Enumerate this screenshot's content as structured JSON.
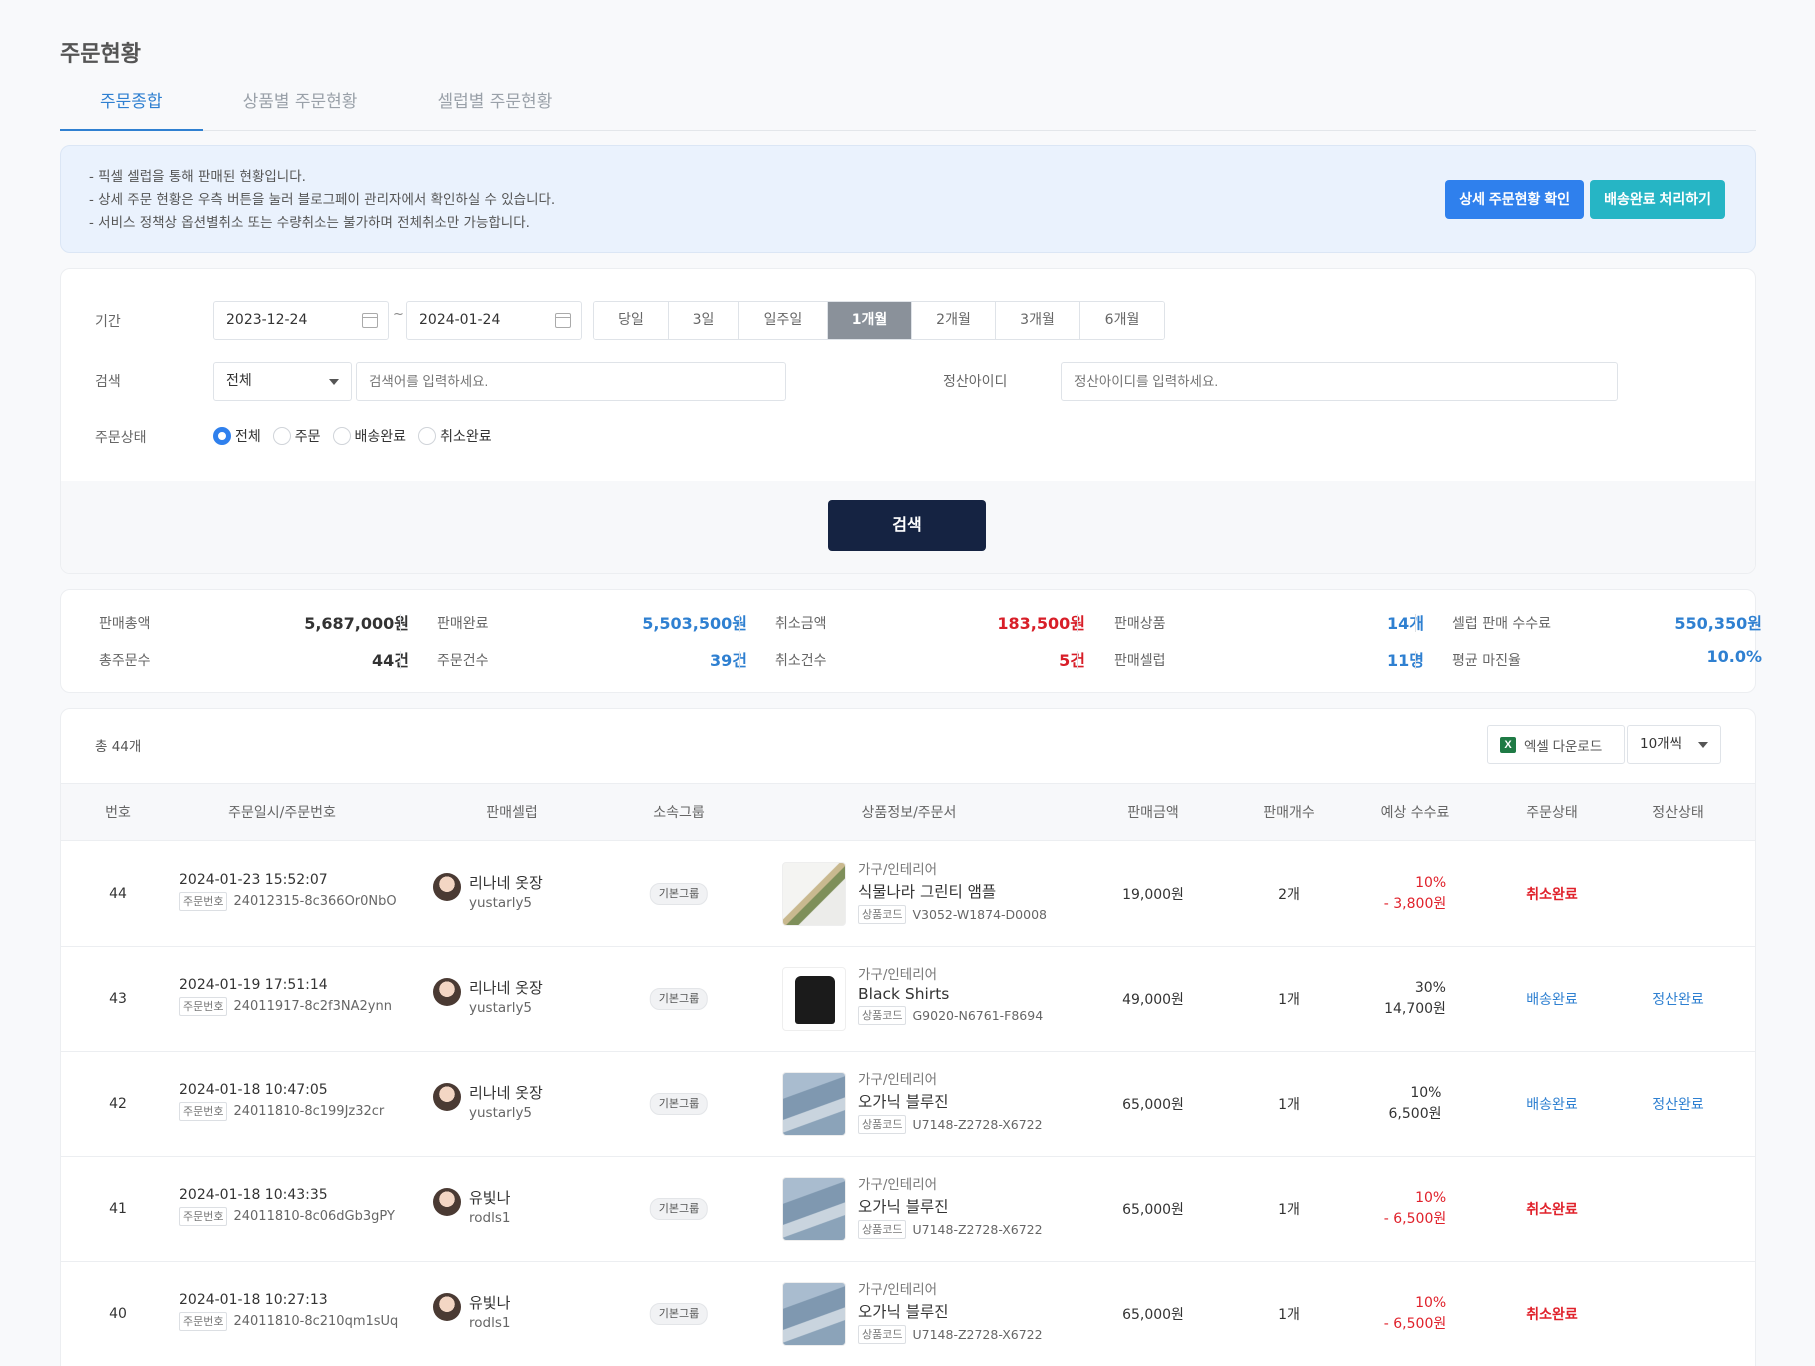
{
  "page_title": "주문현황",
  "tabs": [
    "주문종합",
    "상품별 주문현황",
    "셀럽별 주문현황"
  ],
  "notice": {
    "lines": [
      "- 픽셀 셀럽을 통해 판매된 현황입니다.",
      "- 상세 주문 현황은 우측 버튼을 눌러 블로그페이 관리자에서 확인하실 수 있습니다.",
      "- 서비스 정책상 옵션별취소 또는 수량취소는 불가하며 전체취소만 가능합니다."
    ],
    "detail_button": "상세 주문현황 확인",
    "delivery_button": "배송완료 처리하기"
  },
  "filter": {
    "period_label": "기간",
    "start_date": "2023-12-24",
    "tilde": "~",
    "end_date": "2024-01-24",
    "periods": [
      "당일",
      "3일",
      "일주일",
      "1개월",
      "2개월",
      "3개월",
      "6개월"
    ],
    "active_period": "1개월",
    "search_label": "검색",
    "search_select": "전체",
    "search_placeholder": "검색어를 입력하세요.",
    "settle_label": "정산아이디",
    "settle_placeholder": "정산아이디를 입력하세요.",
    "status_label": "주문상태",
    "status_options": [
      "전체",
      "주문",
      "배송완료",
      "취소완료"
    ],
    "status_selected": "전체",
    "search_button": "검색"
  },
  "summary": {
    "total_sales_label": "판매총액",
    "total_sales": "5,687,000원",
    "completed_label": "판매완료",
    "completed": "5,503,500원",
    "cancel_amount_label": "취소금액",
    "cancel_amount": "183,500원",
    "products_label": "판매상품",
    "products": "14개",
    "commission_label": "셀럽 판매 수수료",
    "commission": "550,350원",
    "total_orders_label": "총주문수",
    "total_orders": "44건",
    "order_count_label": "주문건수",
    "order_count": "39건",
    "cancel_count_label": "취소건수",
    "cancel_count": "5건",
    "sellers_label": "판매셀럽",
    "sellers": "11명",
    "margin_label": "평균 마진율",
    "margin": "10.0%"
  },
  "list": {
    "total": "총 44개",
    "excel_button": "엑셀 다운로드",
    "per_page": "10개씩",
    "headers": [
      "번호",
      "주문일시/주문번호",
      "판매셀럽",
      "소속그룹",
      "상품정보/주문서",
      "판매금액",
      "판매개수",
      "예상 수수료",
      "주문상태",
      "정산상태"
    ],
    "order_no_tag": "주문번호",
    "code_tag": "상품코드",
    "rows": [
      {
        "no": "44",
        "datetime": "2024-01-23 15:52:07",
        "order_no": "24012315-8c366Or0NbO",
        "seller_name": "리나네 옷장",
        "seller_id": "yustarly5",
        "group": "기본그룹",
        "category": "가구/인테리어",
        "product": "식물나라 그린티 앰플",
        "code": "V3052-W1874-D0008",
        "thumb": "plant",
        "amount": "19,000원",
        "qty": "2개",
        "fee_rate": "10%",
        "fee_amount": "- 3,800원",
        "fee_style": "red",
        "status": "취소완료",
        "status_style": "red",
        "settle": ""
      },
      {
        "no": "43",
        "datetime": "2024-01-19 17:51:14",
        "order_no": "24011917-8c2f3NA2ynn",
        "seller_name": "리나네 옷장",
        "seller_id": "yustarly5",
        "group": "기본그룹",
        "category": "가구/인테리어",
        "product": "Black Shirts",
        "code": "G9020-N6761-F8694",
        "thumb": "shirt",
        "amount": "49,000원",
        "qty": "1개",
        "fee_rate": "30%",
        "fee_amount": "14,700원",
        "fee_style": "normal",
        "status": "배송완료",
        "status_style": "blue",
        "settle": "정산완료"
      },
      {
        "no": "42",
        "datetime": "2024-01-18 10:47:05",
        "order_no": "24011810-8c199Jz32cr",
        "seller_name": "리나네 옷장",
        "seller_id": "yustarly5",
        "group": "기본그룹",
        "category": "가구/인테리어",
        "product": "오가닉 블루진",
        "code": "U7148-Z2728-X6722",
        "thumb": "jeans",
        "amount": "65,000원",
        "qty": "1개",
        "fee_rate": "10%",
        "fee_amount": "6,500원",
        "fee_style": "normal",
        "status": "배송완료",
        "status_style": "blue",
        "settle": "정산완료"
      },
      {
        "no": "41",
        "datetime": "2024-01-18 10:43:35",
        "order_no": "24011810-8c06dGb3gPY",
        "seller_name": "유빛나",
        "seller_id": "rodls1",
        "group": "기본그룹",
        "category": "가구/인테리어",
        "product": "오가닉 블루진",
        "code": "U7148-Z2728-X6722",
        "thumb": "jeans",
        "amount": "65,000원",
        "qty": "1개",
        "fee_rate": "10%",
        "fee_amount": "- 6,500원",
        "fee_style": "red",
        "status": "취소완료",
        "status_style": "red",
        "settle": ""
      },
      {
        "no": "40",
        "datetime": "2024-01-18 10:27:13",
        "order_no": "24011810-8c210qm1sUq",
        "seller_name": "유빛나",
        "seller_id": "rodls1",
        "group": "기본그룹",
        "category": "가구/인테리어",
        "product": "오가닉 블루진",
        "code": "U7148-Z2728-X6722",
        "thumb": "jeans",
        "amount": "65,000원",
        "qty": "1개",
        "fee_rate": "10%",
        "fee_amount": "- 6,500원",
        "fee_style": "red",
        "status": "취소완료",
        "status_style": "red",
        "settle": ""
      }
    ]
  },
  "colors": {
    "accent": "#2f80d1",
    "primary_button": "#2f80ed",
    "teal_button": "#26b5c5",
    "search_button": "#152342",
    "cancel_red": "#e0212b"
  }
}
